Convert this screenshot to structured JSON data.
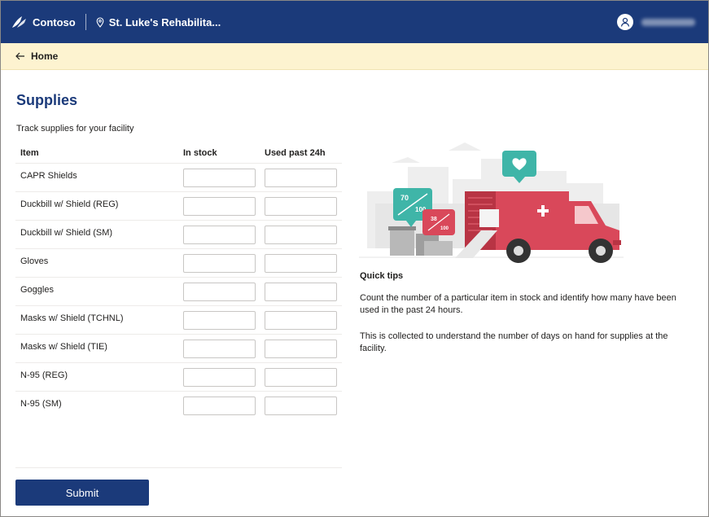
{
  "header": {
    "brand": "Contoso",
    "facility": "St. Luke's Rehabilita...",
    "user_icon": "person-icon"
  },
  "nav": {
    "back_label": "Home",
    "back_icon": "arrow-left-icon"
  },
  "page": {
    "title": "Supplies",
    "subtitle": "Track supplies for your facility"
  },
  "table": {
    "columns": {
      "item": "Item",
      "in_stock": "In stock",
      "used": "Used past 24h"
    },
    "rows": [
      {
        "label": "CAPR Shields",
        "in_stock": "",
        "used": ""
      },
      {
        "label": "Duckbill w/ Shield (REG)",
        "in_stock": "",
        "used": ""
      },
      {
        "label": "Duckbill w/ Shield (SM)",
        "in_stock": "",
        "used": ""
      },
      {
        "label": "Gloves",
        "in_stock": "",
        "used": ""
      },
      {
        "label": "Goggles",
        "in_stock": "",
        "used": ""
      },
      {
        "label": "Masks w/ Shield (TCHNL)",
        "in_stock": "",
        "used": ""
      },
      {
        "label": "Masks w/ Shield (TIE)",
        "in_stock": "",
        "used": ""
      },
      {
        "label": "N-95 (REG)",
        "in_stock": "",
        "used": ""
      },
      {
        "label": "N-95 (SM)",
        "in_stock": "",
        "used": ""
      }
    ]
  },
  "actions": {
    "submit_label": "Submit"
  },
  "illustration": {
    "badge_1_top": "70",
    "badge_1_bottom": "100",
    "badge_2_top": "38",
    "badge_2_bottom": "100"
  },
  "tips": {
    "title": "Quick tips",
    "p1": "Count the number of a particular item in stock and identify how many have been used in the past 24 hours.",
    "p2": "This is collected to understand the number of days on hand for supplies at the facility."
  },
  "colors": {
    "primary": "#1b3a7a",
    "nav_bg": "#fdf3d0",
    "truck": "#d9485a",
    "teal": "#3fb5a8"
  }
}
